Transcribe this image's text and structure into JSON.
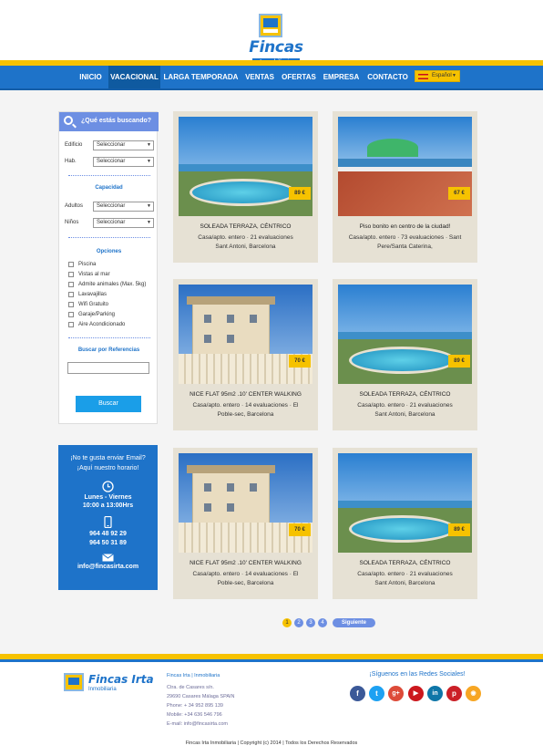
{
  "brand": {
    "name": "Fincas Irta",
    "subtitle": "Inmobiliaria"
  },
  "nav": {
    "items": [
      {
        "label": "INICIO",
        "active": false
      },
      {
        "label": "VACACIONAL",
        "active": true
      },
      {
        "label": "LARGA TEMPORADA",
        "active": false
      },
      {
        "label": "VENTAS",
        "active": false
      },
      {
        "label": "OFERTAS",
        "active": false
      },
      {
        "label": "EMPRESA",
        "active": false
      },
      {
        "label": "CONTACTO",
        "active": false
      }
    ],
    "language": "Español"
  },
  "search": {
    "title": "¿Qué estás buscando?",
    "edificio_label": "Edificio",
    "edificio_value": "Seleccionar",
    "hab_label": "Hab.",
    "hab_value": "Seleccionar",
    "capacidad_title": "Capacidad",
    "adultos_label": "Adultos",
    "adultos_value": "Seleccionar",
    "ninos_label": "Niños",
    "ninos_value": "Seleccionar",
    "opciones_title": "Opciones",
    "options": [
      "Piscina",
      "Vistas al mar",
      "Admite animales (Max. 5kg)",
      "Lavavajillas",
      "Wifi Gratuito",
      "Garaje/Parking",
      "Aire Acondicionado"
    ],
    "ref_title": "Buscar por Referencias",
    "ref_placeholder": "",
    "button": "Buscar"
  },
  "contact": {
    "line1": "¡No te gusta enviar Email?",
    "line2": "¡Aquí nuestro horario!",
    "days": "Lunes - Viernes",
    "hours": "10:00 a 13:00Hrs",
    "phone1": "964 48 92 29",
    "phone2": "964 50 31 89",
    "email": "info@fincasirta.com",
    "icons": [
      "clock-icon",
      "mobile-icon",
      "envelope-icon"
    ]
  },
  "listings": [
    {
      "price": "89 €",
      "title": "SOLEADA TERRAZA, CÉNTRICO",
      "line1": "Casa/apto. entero · 21 evaluaciones",
      "line2": "Sant Antoni, Barcelona",
      "photo": "pool"
    },
    {
      "price": "67 €",
      "title": "Piso bonito en centro de la ciudad!",
      "line1": "Casa/apto. entero · 73 evaluaciones · Sant",
      "line2": "Pere/Santa Caterina,",
      "photo": "terrace"
    },
    {
      "price": "70 €",
      "title": "NICE FLAT 95m2 .10' CENTER WALKING",
      "line1": "Casa/apto. entero · 14 evaluaciones · El",
      "line2": "Poble-sec, Barcelona",
      "photo": "house"
    },
    {
      "price": "89 €",
      "title": "SOLEADA TERRAZA, CÉNTRICO",
      "line1": "Casa/apto. entero · 21 evaluaciones",
      "line2": "Sant Antoni, Barcelona",
      "photo": "pool"
    },
    {
      "price": "70 €",
      "title": "NICE FLAT 95m2 .10' CENTER WALKING",
      "line1": "Casa/apto. entero · 14 evaluaciones · El",
      "line2": "Poble-sec, Barcelona",
      "photo": "house"
    },
    {
      "price": "89 €",
      "title": "SOLEADA TERRAZA, CÉNTRICO",
      "line1": "Casa/apto. entero · 21 evaluaciones",
      "line2": "Sant Antoni, Barcelona",
      "photo": "pool"
    }
  ],
  "pagination": {
    "pages": [
      "1",
      "2",
      "3",
      "4"
    ],
    "current": "1",
    "next": "Siguiente"
  },
  "footer": {
    "company": "Fincas Irta | Inmobiliaria",
    "address1": "Ctra. de Casares s/n.",
    "address2": "29690 Casares Málaga SPAIN",
    "phone": "Phone: + 34 952 895 139",
    "mobile": "Mobile: +34 636 546 796",
    "email": "E-mail: info@fincasirta.com",
    "social_title": "¡Síguenos en las Redes Sociales!",
    "social": [
      {
        "icon": "facebook-icon",
        "glyph": "f",
        "color": "#3b5998"
      },
      {
        "icon": "twitter-icon",
        "glyph": "t",
        "color": "#1da1f2"
      },
      {
        "icon": "google-plus-icon",
        "glyph": "g+",
        "color": "#dd4b39"
      },
      {
        "icon": "youtube-icon",
        "glyph": "▶",
        "color": "#cc181e"
      },
      {
        "icon": "linkedin-icon",
        "glyph": "in",
        "color": "#0e76a8"
      },
      {
        "icon": "pinterest-icon",
        "glyph": "p",
        "color": "#cb2027"
      },
      {
        "icon": "rss-icon",
        "glyph": "◉",
        "color": "#f7a623"
      }
    ],
    "copyright": "Fincas Irta Inmobiliaria | Copyright (c) 2014 | Todos los Derechos Reservados"
  },
  "colors": {
    "primary": "#1e73c9",
    "accent": "#f6c200",
    "panel": "#6d8fe3",
    "card": "#e6e1d4"
  }
}
